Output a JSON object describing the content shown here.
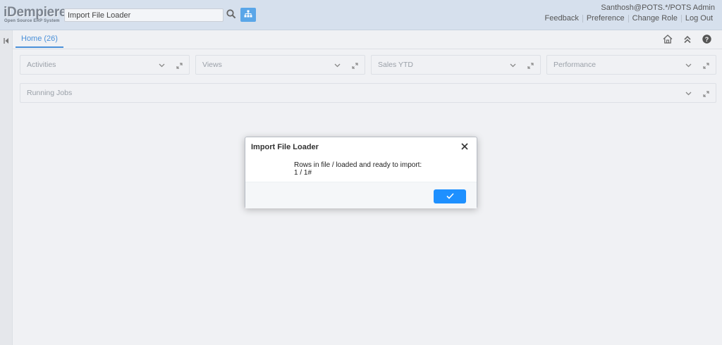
{
  "header": {
    "logo_text": "iDempiere",
    "logo_subtext": "Open Source   ERP System",
    "search_value": "Import File Loader",
    "user": "Santhosh@POTS.*/POTS Admin",
    "links": [
      "Feedback",
      "Preference",
      "Change Role",
      "Log Out"
    ]
  },
  "tabs": {
    "home_label": "Home (26)"
  },
  "panels": [
    "Activities",
    "Views",
    "Sales YTD",
    "Performance",
    "Running Jobs"
  ],
  "dialog": {
    "title": "Import File Loader",
    "message_line1": "Rows in file / loaded and ready to import:",
    "message_line2": "1 / 1#"
  },
  "colors": {
    "accent": "#1e90ff",
    "header_bg": "#d6e0ed",
    "tab_active": "#4a90d9"
  },
  "icons": [
    "search-icon",
    "sitemap-icon",
    "collapse-west-icon",
    "home-icon",
    "double-chevron-up-icon",
    "help-icon",
    "chevron-down-icon",
    "expand-icon",
    "close-icon",
    "check-icon"
  ]
}
